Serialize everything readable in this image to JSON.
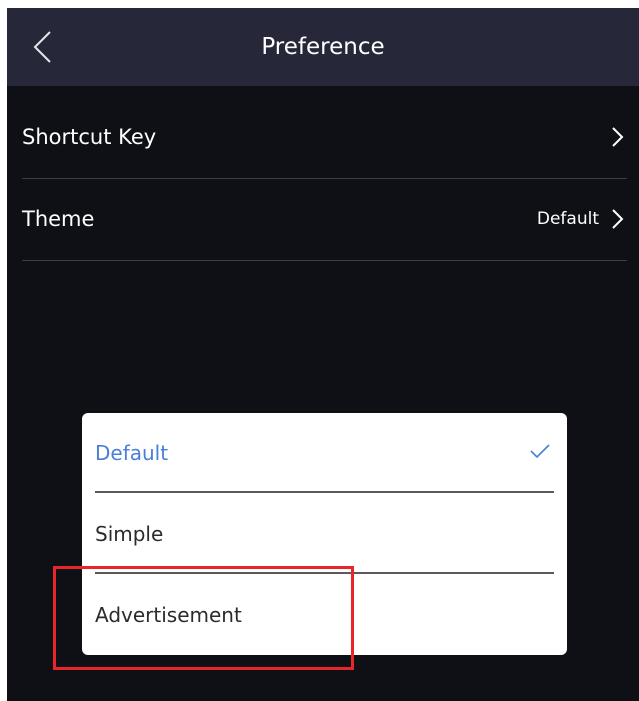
{
  "header": {
    "title": "Preference",
    "back_icon": "chevron-left-icon"
  },
  "settings": [
    {
      "label": "Shortcut Key",
      "value": ""
    },
    {
      "label": "Theme",
      "value": "Default"
    }
  ],
  "theme_dialog": {
    "options": [
      {
        "label": "Default",
        "selected": true
      },
      {
        "label": "Simple",
        "selected": false
      },
      {
        "label": "Advertisement",
        "selected": false
      }
    ]
  },
  "colors": {
    "header_bg": "#262839",
    "screen_bg": "#0f0f16",
    "selected_accent": "#4a7fd9",
    "highlight_box": "#e8262a"
  }
}
